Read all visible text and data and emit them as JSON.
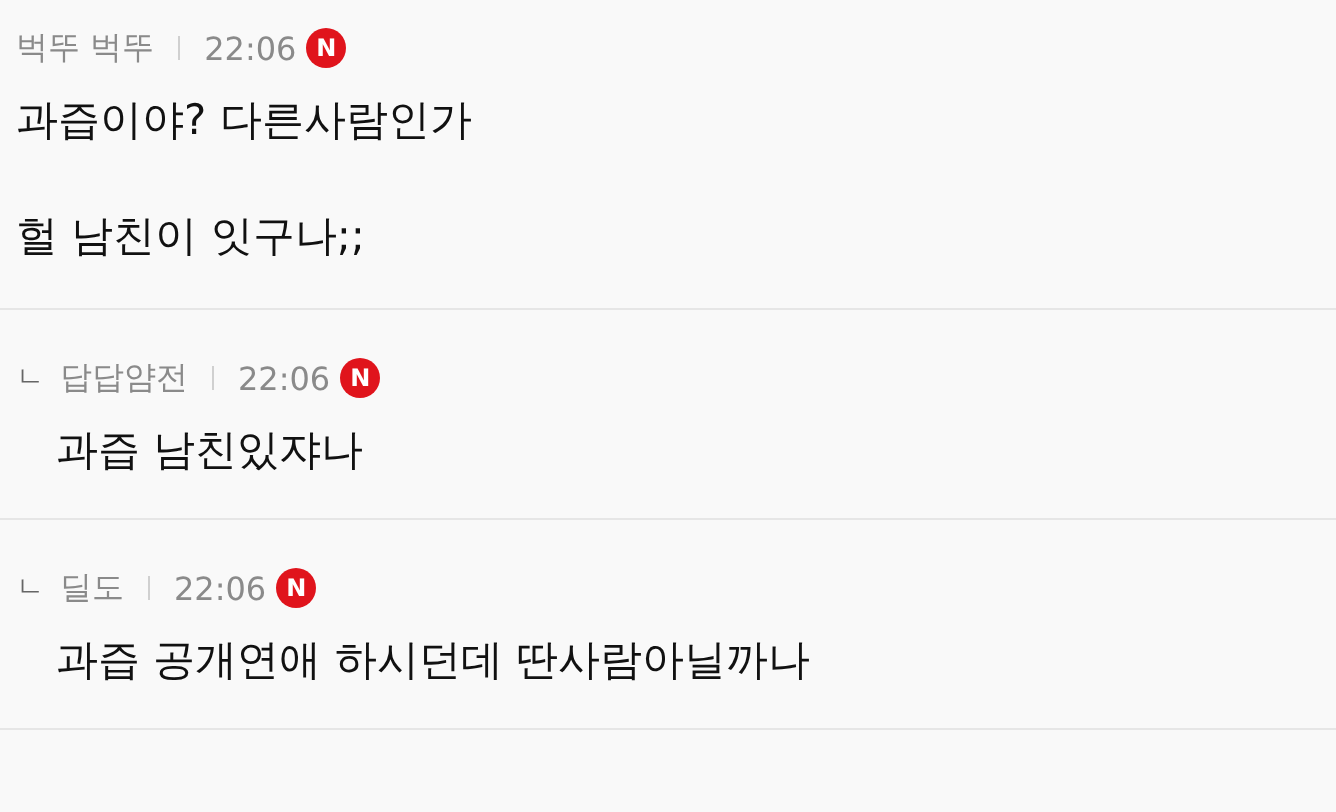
{
  "comments": [
    {
      "kind": "comment",
      "author": "벅뚜 벅뚜",
      "time": "22:06",
      "badge": "N",
      "paragraphs": [
        "과즙이야? 다른사람인가",
        "헐 남친이 잇구나;;"
      ]
    },
    {
      "kind": "reply",
      "reply_mark": "ㄴ",
      "author": "답답얌전",
      "time": "22:06",
      "badge": "N",
      "paragraphs": [
        "과즙 남친있쟈나"
      ]
    },
    {
      "kind": "reply",
      "reply_mark": "ㄴ",
      "author": "딜도",
      "time": "22:06",
      "badge": "N",
      "paragraphs": [
        "과즙 공개연애 하시던데 딴사람아닐까나"
      ]
    }
  ]
}
